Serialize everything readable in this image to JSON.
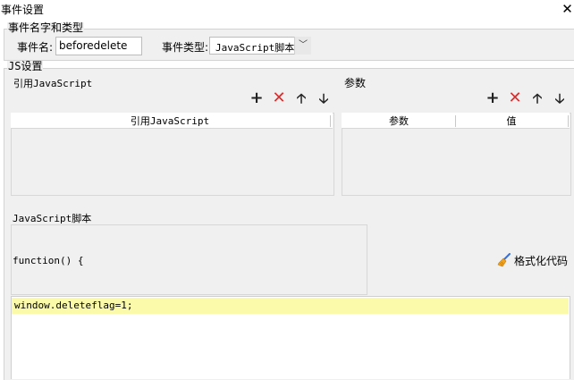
{
  "window": {
    "title": "事件设置",
    "close_glyph": "✕"
  },
  "name_type_group": {
    "legend": "事件名字和类型",
    "event_name_label": "事件名:",
    "event_name_value": "beforedelete",
    "event_type_label": "事件类型:",
    "event_type_value": "JavaScript脚本",
    "event_type_arrow": "﹀"
  },
  "js_group": {
    "legend": "JS设置",
    "ref_js": {
      "title": "引用JavaScript",
      "column": "引用JavaScript",
      "rows": []
    },
    "params": {
      "title": "参数",
      "columns": [
        "参数",
        "值"
      ],
      "rows": []
    },
    "toolbar": {
      "add": "+",
      "delete": "✕",
      "up": "🡡",
      "down": "🡣"
    },
    "script": {
      "title": "JavaScript脚本",
      "function_header": "function() {",
      "format_button": "格式化代码",
      "code_lines": [
        "window.deleteflag=1;"
      ]
    }
  },
  "colors": {
    "delete": "#e02b2b",
    "current_line": "#fafaaa",
    "panel": "#f0f0f0"
  }
}
